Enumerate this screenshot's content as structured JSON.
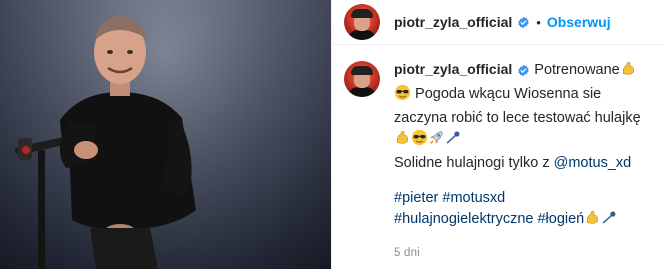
{
  "post": {
    "username": "piotr_zyla_official",
    "follow_label": "Obserwuj",
    "dot": "•",
    "caption": {
      "line_start": "Potrenowane",
      "line2": "Pogoda wkącu Wiosenna sie",
      "line3": "zaczyna robić to lece testować hulajkę",
      "line4_prefix": "Solidne hulajnogi tylko z",
      "mention": "@motus_xd",
      "tag1": "#pieter",
      "tag2": "#motusxd",
      "tag3": "#hulajnogielektryczne",
      "tag4": "#łogień"
    },
    "time": "5 dni"
  },
  "icons": {
    "verified": "verified-badge-icon",
    "muscle": "flexed-biceps-emoji",
    "sunglasses": "sunglasses-emoji",
    "rocket": "rocket-emoji",
    "comet": "comet-emoji"
  },
  "colors": {
    "link": "#00376b",
    "follow": "#0095f6",
    "verified": "#3897f0",
    "muted": "#8e8e8e"
  }
}
